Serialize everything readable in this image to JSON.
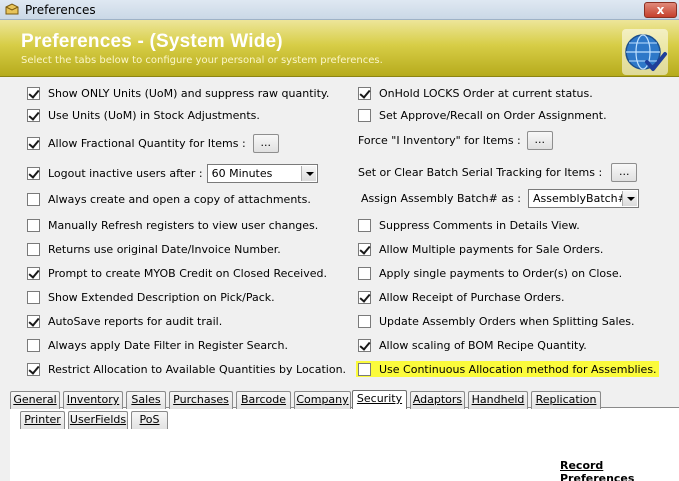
{
  "window": {
    "title": "Preferences",
    "close_label": "x"
  },
  "header": {
    "title": "Preferences - (System Wide)",
    "subtitle": "Select the tabs below to configure your personal or system preferences."
  },
  "left_options": [
    {
      "label": "Show ONLY Units (UoM) and suppress raw quantity.",
      "checked": true
    },
    {
      "label": "Use Units (UoM) in Stock Adjustments.",
      "checked": true
    },
    {
      "label": "Allow Fractional Quantity for Items :",
      "checked": true,
      "button": "..."
    },
    {
      "label": "Logout inactive users after :",
      "checked": true,
      "select": "60 Minutes"
    },
    {
      "label": "Always create and open a copy of attachments.",
      "checked": false
    },
    {
      "label": "Manually Refresh registers to view user changes.",
      "checked": false
    },
    {
      "label": "Returns use original Date/Invoice Number.",
      "checked": false
    },
    {
      "label": "Prompt to create MYOB Credit on Closed Received.",
      "checked": true
    },
    {
      "label": "Show Extended Description on Pick/Pack.",
      "checked": false
    },
    {
      "label": "AutoSave reports for audit trail.",
      "checked": true
    },
    {
      "label": "Always apply Date Filter in Register Search.",
      "checked": false
    },
    {
      "label": "Restrict Allocation to Available Quantities by Location.",
      "checked": true
    }
  ],
  "right_options": {
    "onhold": {
      "label": "OnHold LOCKS Order at current status.",
      "checked": true
    },
    "approve": {
      "label": "Set Approve/Recall on Order Assignment.",
      "checked": false
    },
    "force_inventory": {
      "label": "Force \"I Inventory\" for Items :",
      "button": "..."
    },
    "batch_serial": {
      "label": "Set or Clear Batch Serial Tracking for Items :",
      "button": "..."
    },
    "assembly_batch": {
      "label": "Assign Assembly Batch# as :",
      "select": "AssemblyBatch#"
    },
    "checks": [
      {
        "label": "Suppress Comments in Details View.",
        "checked": false
      },
      {
        "label": "Allow Multiple payments for Sale Orders.",
        "checked": true
      },
      {
        "label": "Apply single payments to Order(s) on Close.",
        "checked": false
      },
      {
        "label": "Allow Receipt of Purchase Orders.",
        "checked": true
      },
      {
        "label": "Update Assembly Orders when Splitting Sales.",
        "checked": false
      },
      {
        "label": "Allow scaling of BOM Recipe Quantity.",
        "checked": true
      },
      {
        "label": "Use Continuous Allocation method for Assemblies.",
        "checked": false,
        "highlight_color": "#fbfb3c"
      }
    ]
  },
  "tabs_row1": [
    "General",
    "Inventory",
    "Sales",
    "Purchases",
    "Barcode",
    "Company",
    "Security",
    "Adaptors",
    "Handheld",
    "Replication"
  ],
  "tabs_row2": [
    "Printer",
    "UserFields",
    "PoS"
  ],
  "active_tab": "Security",
  "record_link": "Record Preferences"
}
